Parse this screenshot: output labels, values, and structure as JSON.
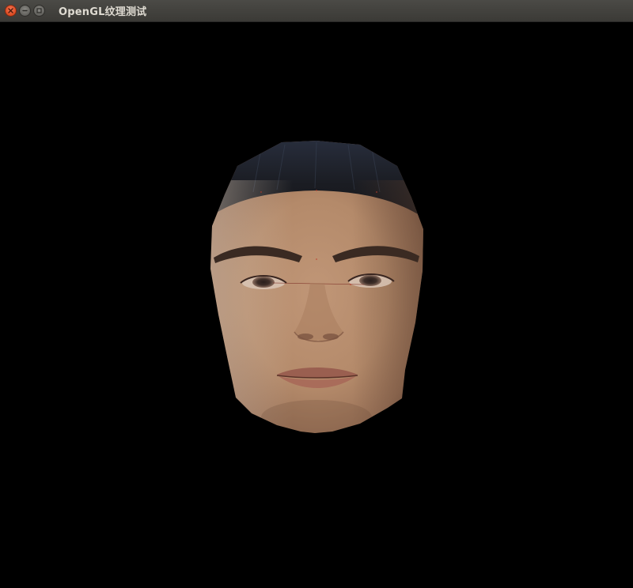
{
  "window": {
    "title": "OpenGL纹理测试",
    "controls": [
      {
        "name": "close",
        "icon": "close-icon"
      },
      {
        "name": "minimize",
        "icon": "minimize-icon"
      },
      {
        "name": "maximize",
        "icon": "maximize-icon"
      }
    ]
  },
  "canvas": {
    "background": "#000000",
    "content": "texture-mapped-face-mesh",
    "colors": {
      "skin": "#b98d6a",
      "skin_shadow": "#8a6248",
      "hair": "#1e2127",
      "lips": "#9a5f50"
    }
  }
}
